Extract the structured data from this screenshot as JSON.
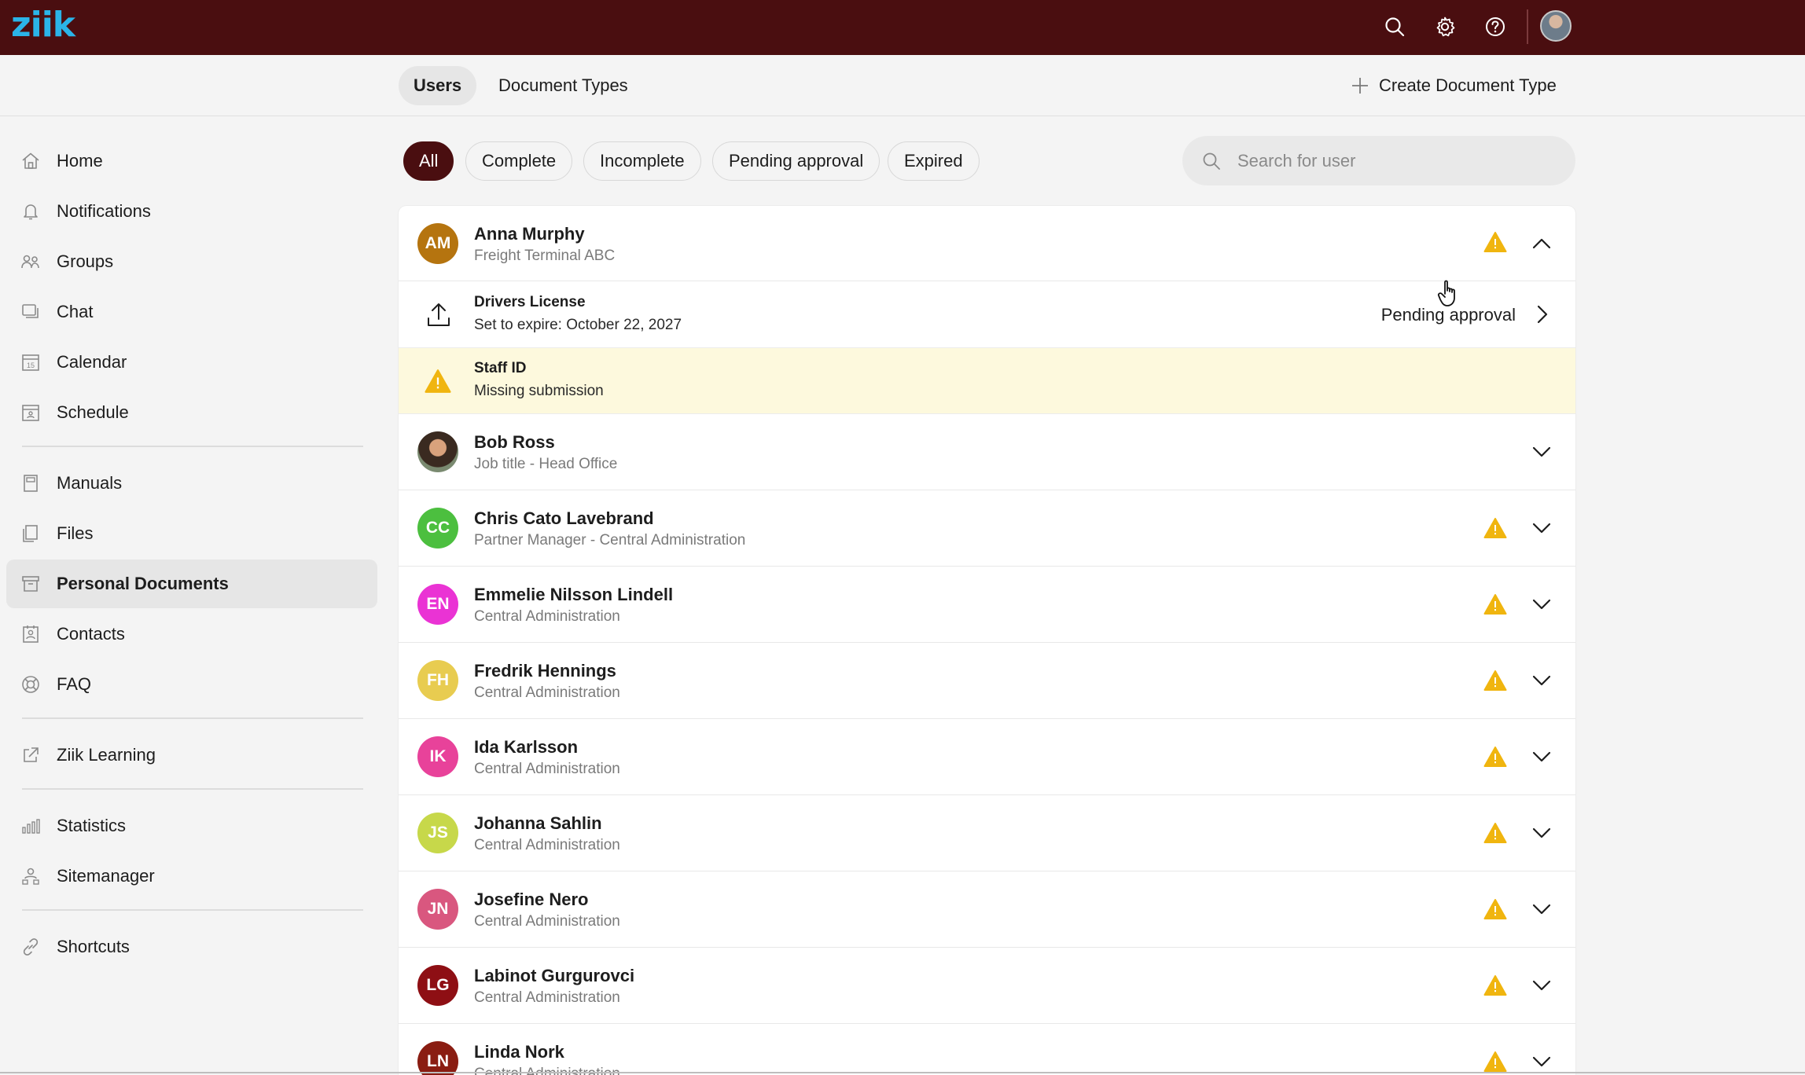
{
  "app": {
    "logo": "ziik"
  },
  "topbar": {
    "icons": [
      "search-icon",
      "gear-icon",
      "help-icon",
      "user-avatar"
    ]
  },
  "tabs": [
    {
      "label": "Users",
      "active": true
    },
    {
      "label": "Document Types",
      "active": false
    }
  ],
  "create_label": "Create Document Type",
  "sidebar": {
    "groups": [
      [
        {
          "label": "Home",
          "icon": "home-icon"
        },
        {
          "label": "Notifications",
          "icon": "bell-icon"
        },
        {
          "label": "Groups",
          "icon": "groups-icon"
        },
        {
          "label": "Chat",
          "icon": "chat-icon"
        },
        {
          "label": "Calendar",
          "icon": "calendar-icon"
        },
        {
          "label": "Schedule",
          "icon": "schedule-icon"
        }
      ],
      [
        {
          "label": "Manuals",
          "icon": "manual-icon"
        },
        {
          "label": "Files",
          "icon": "files-icon"
        },
        {
          "label": "Personal Documents",
          "icon": "archive-icon",
          "active": true
        },
        {
          "label": "Contacts",
          "icon": "contacts-icon"
        },
        {
          "label": "FAQ",
          "icon": "lifebuoy-icon"
        }
      ],
      [
        {
          "label": "Ziik Learning",
          "icon": "external-link-icon"
        }
      ],
      [
        {
          "label": "Statistics",
          "icon": "statistics-icon"
        },
        {
          "label": "Sitemanager",
          "icon": "sitemanager-icon"
        }
      ],
      [
        {
          "label": "Shortcuts",
          "icon": "link-icon"
        }
      ]
    ]
  },
  "filters": [
    {
      "label": "All",
      "active": true
    },
    {
      "label": "Complete"
    },
    {
      "label": "Incomplete"
    },
    {
      "label": "Pending approval"
    },
    {
      "label": "Expired"
    }
  ],
  "search": {
    "placeholder": "Search for user",
    "value": ""
  },
  "colors": {
    "brand": "#4a0e10",
    "accent": "#2bb4e8",
    "warning": "#f0b50f",
    "missing_bg": "#fdf9dd"
  },
  "users": [
    {
      "initials": "AM",
      "name": "Anna Murphy",
      "subtitle": "Freight Terminal ABC",
      "color": "#b5740f",
      "warning": true,
      "expanded": true,
      "documents": [
        {
          "icon": "upload-icon",
          "title": "Drivers License",
          "subtitle": "Set to expire: October 22, 2027",
          "status": "Pending approval",
          "missing": false
        },
        {
          "icon": "warning-icon",
          "title": "Staff ID",
          "subtitle": "Missing submission",
          "status": "",
          "missing": true
        }
      ]
    },
    {
      "initials": "",
      "photo": true,
      "name": "Bob Ross",
      "subtitle": "Job title - Head Office",
      "color": "#6b5a4a",
      "warning": false,
      "expanded": false
    },
    {
      "initials": "CC",
      "name": "Chris Cato Lavebrand",
      "subtitle": "Partner Manager - Central Administration",
      "color": "#4cbf3f",
      "warning": true,
      "expanded": false
    },
    {
      "initials": "EN",
      "name": "Emmelie Nilsson Lindell",
      "subtitle": "Central Administration",
      "color": "#ea33d4",
      "warning": true,
      "expanded": false
    },
    {
      "initials": "FH",
      "name": "Fredrik Hennings",
      "subtitle": "Central Administration",
      "color": "#e8cc50",
      "warning": true,
      "expanded": false
    },
    {
      "initials": "IK",
      "name": "Ida Karlsson",
      "subtitle": "Central Administration",
      "color": "#e8429a",
      "warning": true,
      "expanded": false
    },
    {
      "initials": "JS",
      "name": "Johanna Sahlin",
      "subtitle": "Central Administration",
      "color": "#c7d84a",
      "warning": true,
      "expanded": false
    },
    {
      "initials": "JN",
      "name": "Josefine Nero",
      "subtitle": "Central Administration",
      "color": "#d9577f",
      "warning": true,
      "expanded": false
    },
    {
      "initials": "LG",
      "name": "Labinot Gurgurovci",
      "subtitle": "Central Administration",
      "color": "#8e0f14",
      "warning": true,
      "expanded": false
    },
    {
      "initials": "LN",
      "name": "Linda Nork",
      "subtitle": "Central Administration",
      "color": "#8a1d12",
      "warning": true,
      "expanded": false
    }
  ]
}
